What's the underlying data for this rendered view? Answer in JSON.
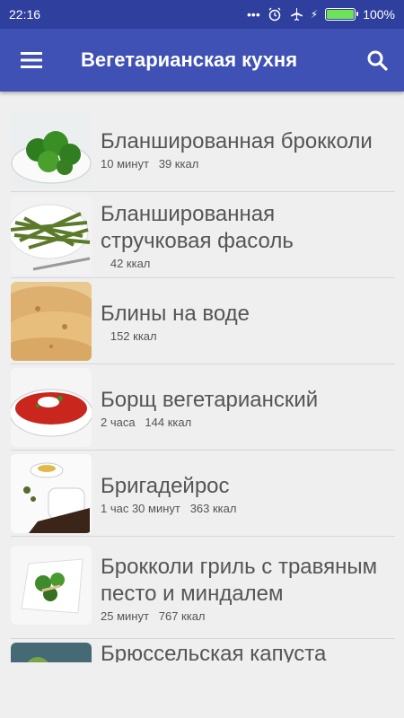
{
  "status": {
    "time": "22:16",
    "battery": "100%"
  },
  "appbar": {
    "title": "Вегетарианская кухня"
  },
  "recipes": [
    {
      "name": "Бланшированная брокколи",
      "meta": "10 минут   39 ккал"
    },
    {
      "name": "Бланшированная стручковая фасоль",
      "meta": "   42 ккал"
    },
    {
      "name": "Блины на воде",
      "meta": "   152 ккал"
    },
    {
      "name": "Борщ вегетарианский",
      "meta": "2 часа   144 ккал"
    },
    {
      "name": "Бригадейрос",
      "meta": "1 час 30 минут   363 ккал"
    },
    {
      "name": "Брокколи гриль с травяным песто и миндалем",
      "meta": "25 минут   767 ккал"
    },
    {
      "name": "Брюссельская капуста",
      "meta": ""
    }
  ]
}
